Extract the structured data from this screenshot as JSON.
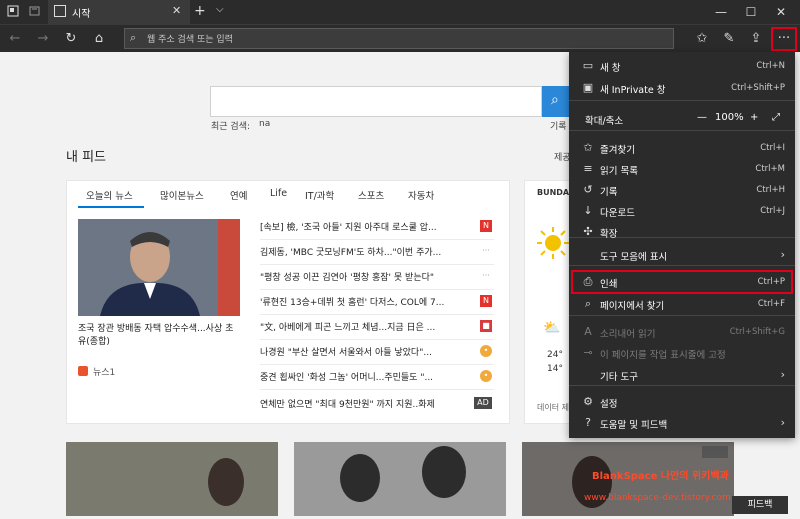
{
  "titlebar": {
    "tab_title": "시작"
  },
  "toolbar": {
    "address_placeholder": "웹 주소 검색 또는 입력"
  },
  "page": {
    "recent_searches_label": "최근 검색:",
    "recent_search_term": "na",
    "record_label": "기록",
    "feed_title": "내 피드",
    "personalize_label": "제공",
    "news_tabs": [
      "오늘의 뉴스",
      "많이본뉴스",
      "연예",
      "Life",
      "IT/과학",
      "스포츠",
      "자동차"
    ],
    "featured_caption": "조국 장관 방배동 자택 압수수색...사상 초유(종합)",
    "featured_source": "뉴스1",
    "headlines": [
      {
        "text": "[속보] 檢, '조국 아들' 지원 아주대 로스쿨 압...",
        "source_icon": "N",
        "source_color": "#e3322b"
      },
      {
        "text": "김제동, 'MBC 굿모닝FM'도 하차...\"이번 주가...",
        "source_icon": "dots",
        "source_color": "#9a9a9a"
      },
      {
        "text": "\"평창 성공 이끈 김연아 '평창 홍잠' 못 받는다\"",
        "source_icon": "dots",
        "source_color": "#9a9a9a"
      },
      {
        "text": "'류현진 13승+데뷔 첫 홈런' 다저스, COL에 7...",
        "source_icon": "N",
        "source_color": "#e3322b"
      },
      {
        "text": "\"文, 아베에게 피곤 느끼고 체념...지금 日은 ...",
        "source_icon": "square",
        "source_color": "#d83b3b"
      },
      {
        "text": "나경원 \"부산 살면서 서울와서 아들 낳았다\"...",
        "source_icon": "circle",
        "source_color": "#f2a93b"
      },
      {
        "text": "중견 횝싸인 '화성 그놈' 어머니...주민들도 \"...",
        "source_icon": "circle",
        "source_color": "#f2a93b"
      },
      {
        "text": "연체만 없으면 \"최대 9천만원\" 까지 지원..화제",
        "source_icon": "AD",
        "source_color": "#4a4a4a"
      }
    ],
    "weather_title": "BUNDA",
    "weather_temps": [
      "24°",
      "14°"
    ],
    "weather_footer": "데이터 제"
  },
  "menu": {
    "items": [
      {
        "label": "새 창",
        "shortcut": "Ctrl+N",
        "icon": "new-window-icon",
        "glyph": "▭"
      },
      {
        "label": "새 InPrivate 창",
        "shortcut": "Ctrl+Shift+P",
        "icon": "inprivate-icon",
        "glyph": "▣"
      },
      {
        "label": "확대/축소",
        "icon": "zoom-icon"
      },
      {
        "label": "즐겨찾기",
        "shortcut": "Ctrl+I",
        "icon": "favorites-icon",
        "glyph": "✩"
      },
      {
        "label": "읽기 목록",
        "shortcut": "Ctrl+M",
        "icon": "reading-list-icon",
        "glyph": "≡"
      },
      {
        "label": "기록",
        "shortcut": "Ctrl+H",
        "icon": "history-icon",
        "glyph": "↺"
      },
      {
        "label": "다운로드",
        "shortcut": "Ctrl+J",
        "icon": "download-icon",
        "glyph": "↓"
      },
      {
        "label": "확장",
        "icon": "extensions-icon",
        "glyph": "✣"
      },
      {
        "label": "도구 모음에 표시",
        "icon": "show-in-toolbar",
        "glyph": ""
      },
      {
        "label": "인쇄",
        "shortcut": "Ctrl+P",
        "icon": "print-icon",
        "glyph": "⎙"
      },
      {
        "label": "페이지에서 찾기",
        "shortcut": "Ctrl+F",
        "icon": "find-icon",
        "glyph": "⌕"
      },
      {
        "label": "소리내어 읽기",
        "shortcut": "Ctrl+Shift+G",
        "icon": "read-aloud-icon",
        "glyph": "A"
      },
      {
        "label": "이 페이지를 작업 표시줄에 고정",
        "icon": "pin-icon",
        "glyph": "⊸"
      },
      {
        "label": "기타 도구",
        "icon": "more-tools",
        "glyph": ""
      },
      {
        "label": "설정",
        "icon": "settings-icon",
        "glyph": "⚙"
      },
      {
        "label": "도움말 및 피드백",
        "icon": "help-icon",
        "glyph": "?"
      }
    ],
    "zoom_value": "100%",
    "zoom_minus": "—",
    "zoom_plus": "+"
  },
  "watermark": {
    "line1": "BlankSpace 나만의 위키백과",
    "line2": "www.blankspace-dev.tistory.com"
  },
  "feedback_label": "피드백",
  "colors": {
    "accent": "#0078d7",
    "highlight": "#e0001b",
    "menu_bg": "#2b2b2b"
  }
}
